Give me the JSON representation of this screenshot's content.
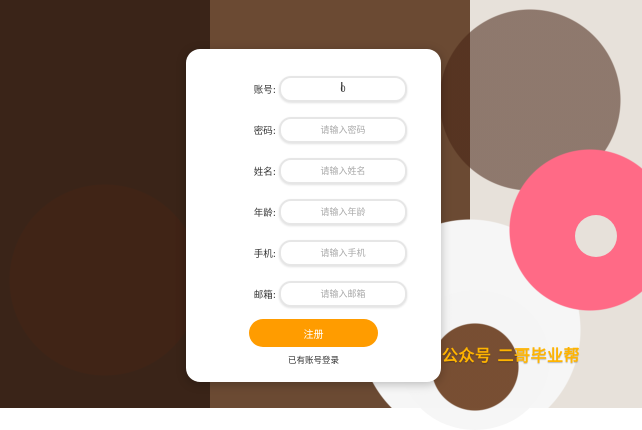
{
  "form": {
    "fields": [
      {
        "label": "账号:",
        "value": "0",
        "placeholder": ""
      },
      {
        "label": "密码:",
        "value": "",
        "placeholder": "请输入密码"
      },
      {
        "label": "姓名:",
        "value": "",
        "placeholder": "请输入姓名"
      },
      {
        "label": "年龄:",
        "value": "",
        "placeholder": "请输入年龄"
      },
      {
        "label": "手机:",
        "value": "",
        "placeholder": "请输入手机"
      },
      {
        "label": "邮箱:",
        "value": "",
        "placeholder": "请输入邮箱"
      }
    ],
    "submit_label": "注册",
    "login_link": "已有账号登录"
  },
  "watermark": "公众号 二哥毕业帮",
  "colors": {
    "accent": "#ff9c00",
    "card": "#ffffff",
    "watermark": "#ffb400"
  }
}
